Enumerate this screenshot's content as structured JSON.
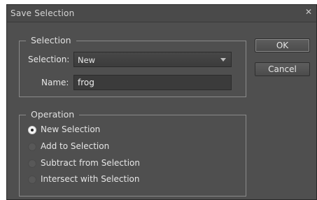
{
  "window": {
    "title": "Save Selection"
  },
  "selection_group": {
    "legend": "Selection",
    "selection_label": "Selection:",
    "selection_value": "New",
    "name_label": "Name:",
    "name_value": "frog"
  },
  "operation_group": {
    "legend": "Operation",
    "options": [
      {
        "label": "New Selection",
        "checked": true
      },
      {
        "label": "Add to Selection",
        "checked": false
      },
      {
        "label": "Subtract from Selection",
        "checked": false
      },
      {
        "label": "Intersect with Selection",
        "checked": false
      }
    ]
  },
  "buttons": {
    "ok": "OK",
    "cancel": "Cancel"
  },
  "icons": {
    "close": "close-icon",
    "dropdown": "chevron-down-icon"
  }
}
